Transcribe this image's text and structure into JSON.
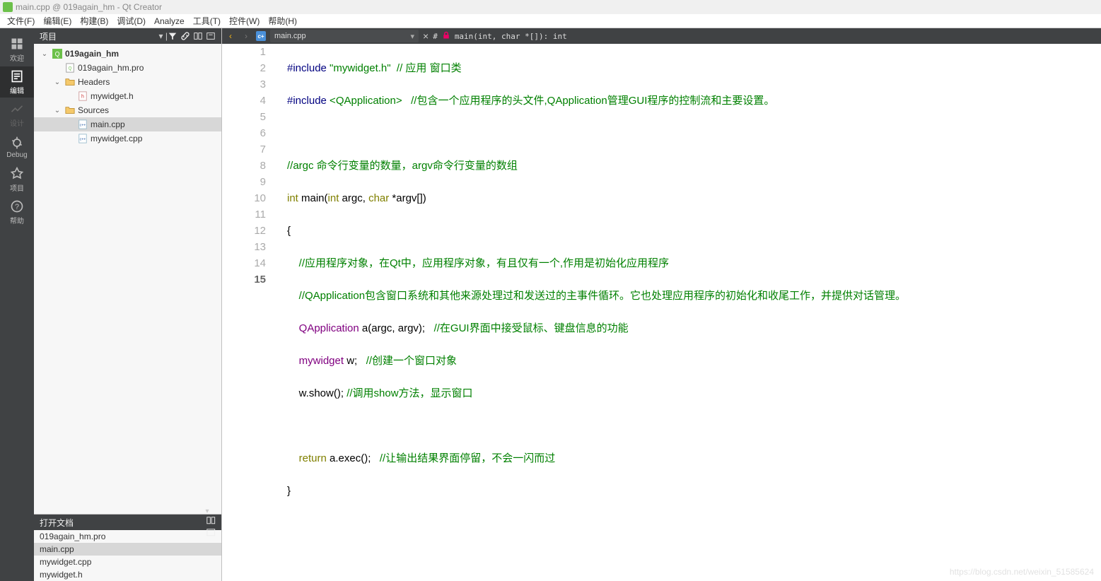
{
  "window": {
    "title": "main.cpp @ 019again_hm - Qt Creator"
  },
  "menu": {
    "file": "文件(F)",
    "edit": "编辑(E)",
    "build": "构建(B)",
    "debug": "调试(D)",
    "analyze": "Analyze",
    "tools": "工具(T)",
    "widgets": "控件(W)",
    "help": "帮助(H)"
  },
  "leftbar": {
    "welcome": "欢迎",
    "edit": "编辑",
    "design": "设计",
    "debug": "Debug",
    "projects": "项目",
    "help": "帮助"
  },
  "project_panel": {
    "title": "项目",
    "root": "019again_hm",
    "pro_file": "019again_hm.pro",
    "headers": "Headers",
    "header_file": "mywidget.h",
    "sources": "Sources",
    "src1": "main.cpp",
    "src2": "mywidget.cpp"
  },
  "open_docs": {
    "title": "打开文档",
    "d1": "019again_hm.pro",
    "d2": "main.cpp",
    "d3": "mywidget.cpp",
    "d4": "mywidget.h"
  },
  "editor_bar": {
    "file": "main.cpp",
    "symbol": "main(int, char *[]): int",
    "hash": "#"
  },
  "code": {
    "l1a": "#include",
    "l1b": " \"mywidget.h\"",
    "l1c": "  // 应用 窗口类",
    "l2a": "#include",
    "l2b": " <QApplication>",
    "l2c": "   //包含一个应用程序的头文件,QApplication管理GUI程序的控制流和主要设置。",
    "l3": "",
    "l4": "//argc 命令行变量的数量，argv命令行变量的数组",
    "l5a": "int",
    "l5b": " main(",
    "l5c": "int",
    "l5d": " argc, ",
    "l5e": "char",
    "l5f": " *argv[])",
    "l6": "{",
    "l7": "    //应用程序对象，在Qt中，应用程序对象，有且仅有一个,作用是初始化应用程序",
    "l8": "    //QApplication包含窗口系统和其他来源处理过和发送过的主事件循环。它也处理应用程序的初始化和收尾工作，并提供对话管理。",
    "l9a": "    QApplication",
    "l9b": " a(argc, argv);   ",
    "l9c": "//在GUI界面中接受鼠标、键盘信息的功能",
    "l10a": "    mywidget",
    "l10b": " w;   ",
    "l10c": "//创建一个窗口对象",
    "l11a": "    w.show(); ",
    "l11c": "//调用show方法，显示窗口",
    "l12": "",
    "l13a": "    return",
    "l13b": " a.exec();   ",
    "l13c": "//让输出结果界面停留，不会一闪而过",
    "l14": "}",
    "l15": ""
  },
  "lines": [
    "1",
    "2",
    "3",
    "4",
    "5",
    "6",
    "7",
    "8",
    "9",
    "10",
    "11",
    "12",
    "13",
    "14",
    "15"
  ],
  "watermark": "https://blog.csdn.net/weixin_51585624"
}
